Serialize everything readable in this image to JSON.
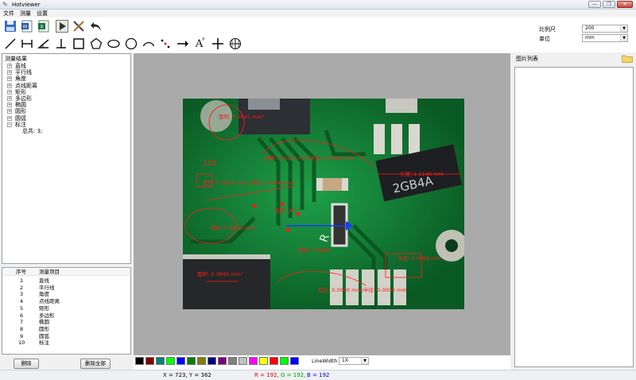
{
  "window": {
    "title": "Hotviewer",
    "min_glyph": "—",
    "restore_glyph": "❐",
    "close_glyph": "✕"
  },
  "menu": [
    "文件",
    "测量",
    "设置"
  ],
  "toolbar": {
    "row1_icons": [
      "save-icon",
      "export-word-icon",
      "export-excel-icon",
      "play-icon",
      "clear-tools-icon",
      "undo-arrow-icon"
    ],
    "row2_icons": [
      "line-icon",
      "dimension-line-icon",
      "angle-icon",
      "perpendicular-icon",
      "rectangle-icon",
      "polygon-icon",
      "ellipse-icon",
      "circle-icon",
      "arc-icon",
      "point-distance-icon",
      "arrow-icon",
      "text-label-icon",
      "crosshair-icon",
      "grid-target-icon"
    ],
    "text_tool_glyph": "A",
    "text_tool_sup": "字"
  },
  "settings": {
    "scale_label": "比例尺",
    "scale_value": "200",
    "unit_label": "单位",
    "unit_value": "mm"
  },
  "results_tree": {
    "root": "测量结果",
    "items": [
      "直线",
      "平行线",
      "角度",
      "点线距离",
      "矩形",
      "多边形",
      "椭圆",
      "圆形",
      "圆弧",
      "标注"
    ],
    "expanded_child": "总共: 3;"
  },
  "items_table": {
    "headers": [
      "序号",
      "测量项目"
    ],
    "rows": [
      [
        "1",
        "直线"
      ],
      [
        "2",
        "平行线"
      ],
      [
        "3",
        "角度"
      ],
      [
        "4",
        "点线距离"
      ],
      [
        "5",
        "矩形"
      ],
      [
        "6",
        "多边形"
      ],
      [
        "7",
        "椭圆"
      ],
      [
        "8",
        "圆形"
      ],
      [
        "9",
        "圆弧"
      ],
      [
        "10",
        "标注"
      ]
    ]
  },
  "buttons": {
    "delete": "删除",
    "delete_all": "删除全部"
  },
  "image_list": {
    "title": "图片列表"
  },
  "palette": {
    "colors": [
      "#000000",
      "#7f0000",
      "#007f7f",
      "#00ff00",
      "#0000ff",
      "#008000",
      "#7f7f00",
      "#00007f",
      "#7f007f",
      "#808080",
      "#c0c0c0",
      "#ff00ff",
      "#ffff00",
      "#ff0000",
      "#00ff00",
      "#0000ff"
    ],
    "linewidth_label": "LineWidth",
    "linewidth_value": "1X"
  },
  "annotations": {
    "board_label": "123",
    "chip_marking": "2GB4A",
    "board_letter": "R"
  },
  "status": {
    "coords": "X = 723, Y = 362",
    "r": "R = 192,",
    "g": "G = 192,",
    "b": "B = 192"
  },
  "colors": {
    "accent_red": "#ff1a1a",
    "accent_blue": "#1a3cff",
    "pcb_green": "#0e7a32"
  }
}
